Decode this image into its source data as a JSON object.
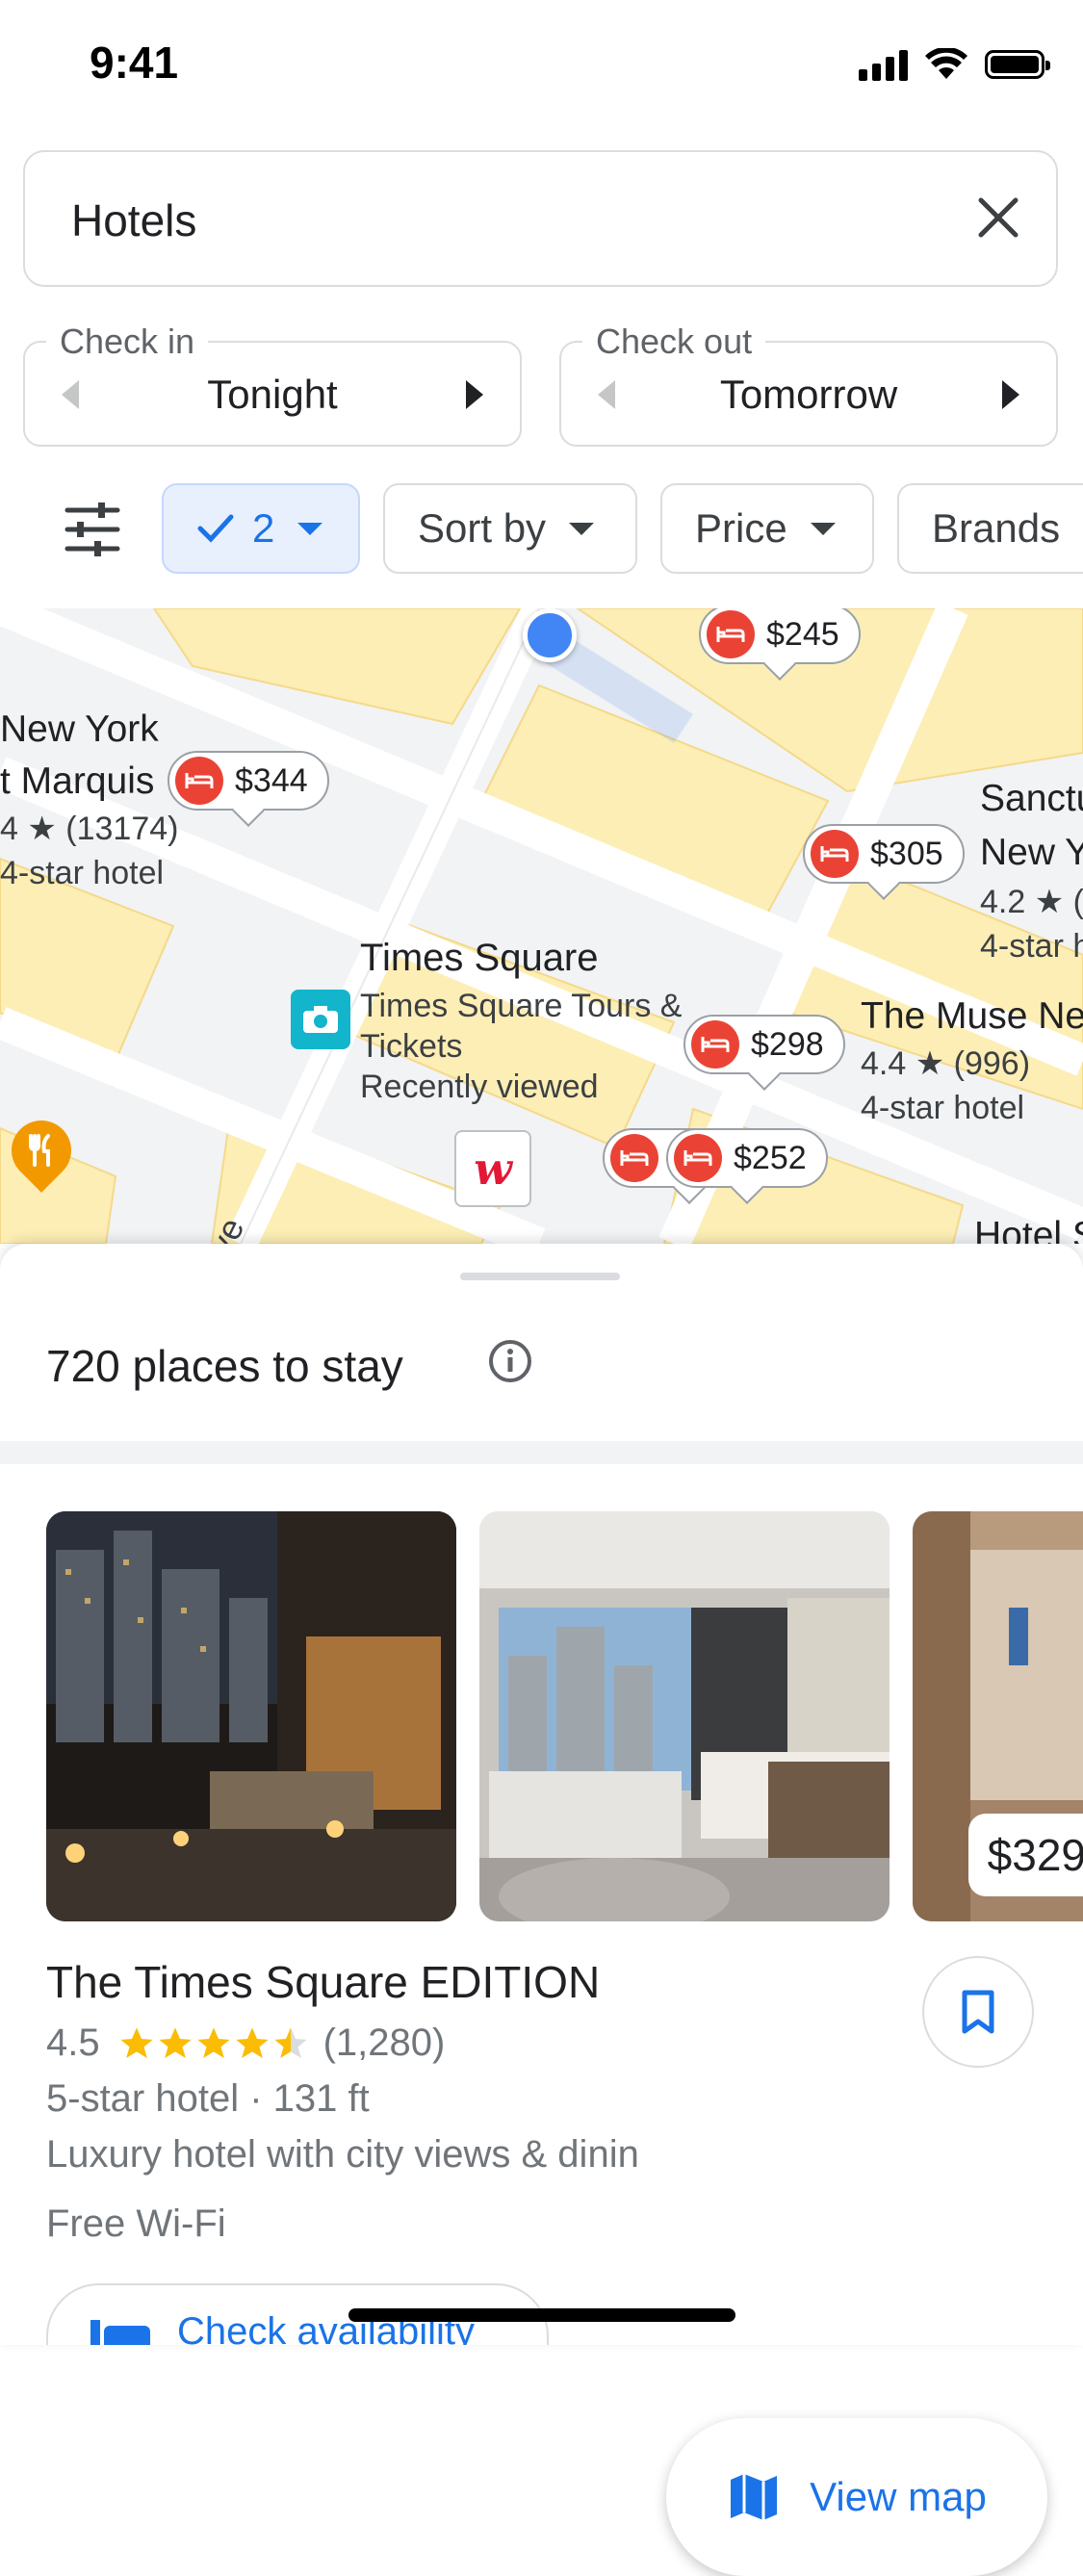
{
  "status_bar": {
    "time": "9:41"
  },
  "search": {
    "query": "Hotels"
  },
  "dates": {
    "check_in": {
      "label": "Check in",
      "value": "Tonight"
    },
    "check_out": {
      "label": "Check out",
      "value": "Tomorrow"
    }
  },
  "filters": {
    "guests": "2",
    "sort": "Sort by",
    "price": "Price",
    "brands": "Brands"
  },
  "map": {
    "places": [
      {
        "name_line1": "New York",
        "name_line2": "t Marquis",
        "rating": "4 ★ (13174)",
        "class": "4-star hotel"
      },
      {
        "name_line1": "Sanctu",
        "name_line2": "New Y",
        "rating": "4.2 ★ (",
        "class": "4-star h"
      },
      {
        "name_line1": "The Muse Ne",
        "rating": "4.4 ★ (996)",
        "class": "4-star hotel"
      },
      {
        "name_line1": "Hotel S"
      }
    ],
    "poi": {
      "title": "Times Square",
      "line1": "Times Square Tours &",
      "line2": "Tickets",
      "line3": "Recently viewed"
    },
    "street": "ve",
    "pins": [
      "$245",
      "$344",
      "$305",
      "$298",
      "$252"
    ]
  },
  "results": {
    "count_label": "720 places to stay",
    "hotel": {
      "name": "The Times Square EDITION",
      "rating": "4.5",
      "reviews": "(1,280)",
      "meta": "5-star hotel · 131 ft",
      "description": "Luxury hotel with city views & dinin",
      "amenity": "Free Wi-Fi",
      "photo_price": "$329"
    },
    "view_map_label": "View map",
    "check_availability_label": "Check availability"
  },
  "colors": {
    "accent": "#1a73e8",
    "hotel_pin": "#ea4335",
    "star": "#fbbc04",
    "map_building": "#fdeeb5"
  },
  "icons": [
    "close-icon",
    "tune-icon",
    "check-icon",
    "info-icon",
    "bookmark-icon",
    "map-icon",
    "hotel-bed-icon",
    "camera-icon",
    "restaurant-icon",
    "walgreens-logo",
    "calendar-bed-icon"
  ]
}
